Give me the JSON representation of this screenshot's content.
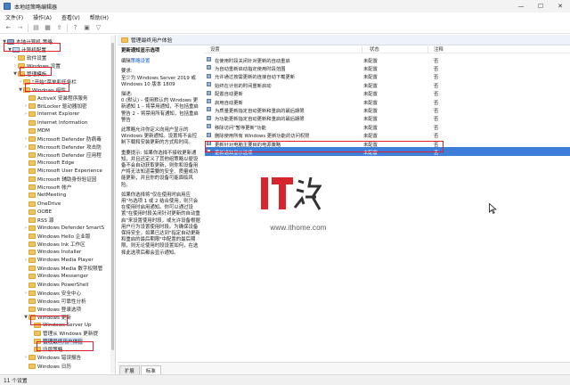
{
  "window": {
    "title": "本地组策略编辑器",
    "controls": {
      "minimize": "—",
      "maximize": "☐",
      "close": "✕"
    }
  },
  "menubar": [
    "文件(F)",
    "操作(A)",
    "查看(V)",
    "帮助(H)"
  ],
  "toolbar_icons": [
    "back-icon",
    "forward-icon",
    "up-folder-icon",
    "show-hide-tree-icon",
    "export-list-icon",
    "properties-icon",
    "help-icon",
    "filter-icon"
  ],
  "tree": {
    "items": [
      {
        "label": "本地计算机 策略",
        "icon": "settings-icon",
        "level": 0,
        "twisty": "▼"
      },
      {
        "label": "计算机配置",
        "icon": "computer-icon",
        "level": 1,
        "twisty": "▼"
      },
      {
        "label": "软件设置",
        "icon": "folder-icon",
        "level": 2,
        "twisty": "›"
      },
      {
        "label": "Windows 设置",
        "icon": "folder-icon",
        "level": 2,
        "twisty": "›"
      },
      {
        "label": "管理模板",
        "icon": "folder-icon",
        "level": 2,
        "twisty": "▼"
      },
      {
        "label": "\"开始\"菜单和任务栏",
        "icon": "folder-icon",
        "level": 3,
        "twisty": "›"
      },
      {
        "label": "Windows 组件",
        "icon": "folder-icon",
        "level": 3,
        "twisty": "▼"
      },
      {
        "label": "ActiveX 安装程序服务",
        "icon": "folder-icon",
        "level": 4,
        "twisty": ""
      },
      {
        "label": "BitLocker 驱动器加密",
        "icon": "folder-icon",
        "level": 4,
        "twisty": "›"
      },
      {
        "label": "Internet Explorer",
        "icon": "folder-icon",
        "level": 4,
        "twisty": "›"
      },
      {
        "label": "Internet Information",
        "icon": "folder-icon",
        "level": 4,
        "twisty": ""
      },
      {
        "label": "MDM",
        "icon": "folder-icon",
        "level": 4,
        "twisty": ""
      },
      {
        "label": "Microsoft Defender 防病毒",
        "icon": "folder-icon",
        "level": 4,
        "twisty": "›"
      },
      {
        "label": "Microsoft Defender 攻击防",
        "icon": "folder-icon",
        "level": 4,
        "twisty": "›"
      },
      {
        "label": "Microsoft Defender 应用程",
        "icon": "folder-icon",
        "level": 4,
        "twisty": ""
      },
      {
        "label": "Microsoft Edge",
        "icon": "folder-icon",
        "level": 4,
        "twisty": ""
      },
      {
        "label": "Microsoft User Experience",
        "icon": "folder-icon",
        "level": 4,
        "twisty": ""
      },
      {
        "label": "Microsoft 辅助身份验证因",
        "icon": "folder-icon",
        "level": 4,
        "twisty": ""
      },
      {
        "label": "Microsoft 帐户",
        "icon": "folder-icon",
        "level": 4,
        "twisty": ""
      },
      {
        "label": "NetMeeting",
        "icon": "folder-icon",
        "level": 4,
        "twisty": ""
      },
      {
        "label": "OneDrive",
        "icon": "folder-icon",
        "level": 4,
        "twisty": ""
      },
      {
        "label": "OOBE",
        "icon": "folder-icon",
        "level": 4,
        "twisty": ""
      },
      {
        "label": "RSS 源",
        "icon": "folder-icon",
        "level": 4,
        "twisty": ""
      },
      {
        "label": "Windows Defender SmartS",
        "icon": "folder-icon",
        "level": 4,
        "twisty": "›"
      },
      {
        "label": "Windows Hello 企业版",
        "icon": "folder-icon",
        "level": 4,
        "twisty": ""
      },
      {
        "label": "Windows Ink 工作区",
        "icon": "folder-icon",
        "level": 4,
        "twisty": ""
      },
      {
        "label": "Windows Installer",
        "icon": "folder-icon",
        "level": 4,
        "twisty": ""
      },
      {
        "label": "Windows Media Player",
        "icon": "folder-icon",
        "level": 4,
        "twisty": "›"
      },
      {
        "label": "Windows Media 数字权限管",
        "icon": "folder-icon",
        "level": 4,
        "twisty": ""
      },
      {
        "label": "Windows Messenger",
        "icon": "folder-icon",
        "level": 4,
        "twisty": ""
      },
      {
        "label": "Windows PowerShell",
        "icon": "folder-icon",
        "level": 4,
        "twisty": ""
      },
      {
        "label": "Windows 安全中心",
        "icon": "folder-icon",
        "level": 4,
        "twisty": "›"
      },
      {
        "label": "Windows 可靠性分析",
        "icon": "folder-icon",
        "level": 4,
        "twisty": ""
      },
      {
        "label": "Windows 登录选项",
        "icon": "folder-icon",
        "level": 4,
        "twisty": ""
      },
      {
        "label": "Windows 更新",
        "icon": "folder-icon",
        "level": 4,
        "twisty": "▼"
      },
      {
        "label": "Windows Server Up",
        "icon": "folder-icon",
        "level": 5,
        "twisty": ""
      },
      {
        "label": "管理从 Windows 更新提",
        "icon": "folder-icon",
        "level": 5,
        "twisty": ""
      },
      {
        "label": "管理最终用户体验",
        "icon": "folder-icon",
        "level": 5,
        "twisty": ""
      },
      {
        "label": "旧版策略",
        "icon": "folder-icon",
        "level": 5,
        "twisty": ""
      },
      {
        "label": "Windows 错误报告",
        "icon": "folder-icon",
        "level": 4,
        "twisty": "›"
      },
      {
        "label": "Windows 日历",
        "icon": "folder-icon",
        "level": 4,
        "twisty": ""
      }
    ]
  },
  "main": {
    "header": "管理最终用户体验",
    "description": {
      "heading": "更新通知显示选项",
      "edit_prefix": "编辑",
      "edit_link": "策略设置",
      "requirements_label": "要求:",
      "requirements_text": "至少为 Windows Server 2019 或 Windows 10 版本 1809",
      "description_label": "描述:",
      "description_text": "0 (默认) – 使用默认的 Windows 更新通知 1 – 将禁用通知，不包括重启警告 2 – 将禁用所有通知，包括重启警告",
      "policy_text": "此策略允许你定义向用户显示的 Windows 更新通知。设置将不会控制下载和安装更新的方式和时间。",
      "important_text": "重要提示: 如果你选择不接收更新通知，并且还定义了其他组策略以便设备不会自动获取更新，则你和设备用户将无法知道需要的安全、质量或功能更新，并且你的设备可能面临风险。",
      "extra_text": "如果你选择将\"仅在使用时启用应用\"与选项 1 或 2 结合使用，则只会在使用时启用通知。你可以通过设置\"在使用时段关闭针对更新的自动重启\"来设置使用时段，或允许设备根据用户行为设置使用时段。为确保设备保持安全，如果已达到\"指定自动更新和重启的最后期限\"中配置的最后期限，则无论使用时段设置如何，在选择此选项后都会显示通知。"
    },
    "columns": {
      "setting": "设置",
      "state": "状态",
      "comment": "注释"
    },
    "policies": [
      {
        "name": "在使用时段关闭针对更新的自动重启",
        "state": "未配置",
        "comment": "否"
      },
      {
        "name": "为自动重新启动指定使用时段范围",
        "state": "未配置",
        "comment": "否"
      },
      {
        "name": "允许通过按需更新的连接自动下载更新",
        "state": "未配置",
        "comment": "否"
      },
      {
        "name": "始终在计划的时间重新启动",
        "state": "未配置",
        "comment": "否"
      },
      {
        "name": "配置自动更新",
        "state": "未配置",
        "comment": "否"
      },
      {
        "name": "启用自动更新",
        "state": "未配置",
        "comment": "否"
      },
      {
        "name": "为质量更新指定自动更新和重启的最后期限",
        "state": "未配置",
        "comment": "否"
      },
      {
        "name": "为功能更新指定自动更新和重启的最后期限",
        "state": "未配置",
        "comment": "否"
      },
      {
        "name": "移除访问\"暂停更新\"功能",
        "state": "未配置",
        "comment": "否"
      },
      {
        "name": "删除使用所有 Windows 更新功能的访问权限",
        "state": "未配置",
        "comment": "否"
      },
      {
        "name": "更新针对电脑主要目的电源策略",
        "state": "未配置",
        "comment": "否"
      },
      {
        "name": "更新通知显示选项",
        "state": "未配置",
        "comment": "否"
      }
    ],
    "tabs": [
      "扩展",
      "标准"
    ]
  },
  "statusbar": {
    "text": "11 个设置"
  },
  "watermark": {
    "logo": "IT之家",
    "url": "www.ithome.com"
  },
  "colors": {
    "highlight_box": "#e0202e",
    "selection": "#3d7fd8",
    "link": "#0b57c7"
  }
}
